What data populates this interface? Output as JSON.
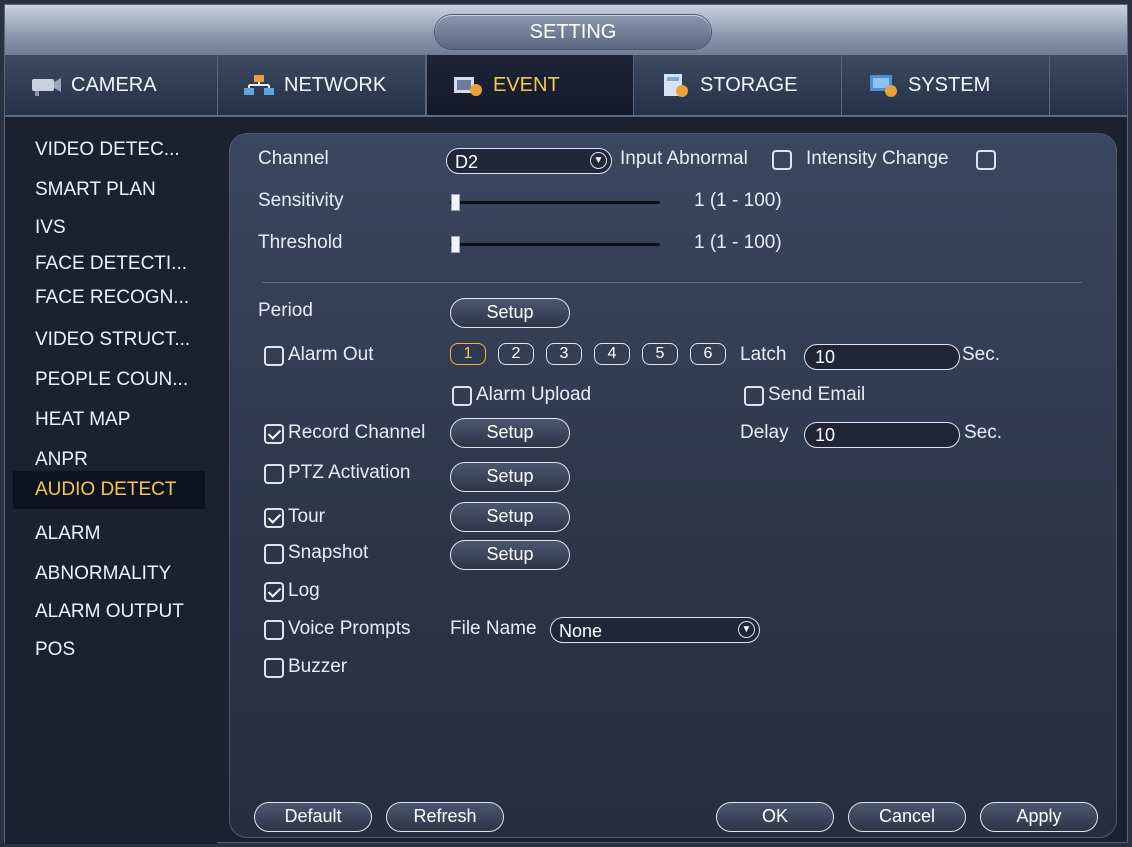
{
  "window": {
    "title": "SETTING"
  },
  "tabs": [
    {
      "label": "CAMERA",
      "icon": "camera-icon"
    },
    {
      "label": "NETWORK",
      "icon": "network-icon"
    },
    {
      "label": "EVENT",
      "icon": "event-icon",
      "active": true
    },
    {
      "label": "STORAGE",
      "icon": "storage-icon"
    },
    {
      "label": "SYSTEM",
      "icon": "system-icon"
    }
  ],
  "sidebar": {
    "items": [
      {
        "label": "VIDEO DETEC..."
      },
      {
        "label": "SMART PLAN"
      },
      {
        "label": "IVS"
      },
      {
        "label": "FACE DETECTI..."
      },
      {
        "label": "FACE RECOGN..."
      },
      {
        "label": "VIDEO STRUCT..."
      },
      {
        "label": "PEOPLE COUN..."
      },
      {
        "label": "HEAT MAP"
      },
      {
        "label": "ANPR"
      },
      {
        "label": "AUDIO DETECT",
        "active": true
      },
      {
        "label": "ALARM"
      },
      {
        "label": "ABNORMALITY"
      },
      {
        "label": "ALARM OUTPUT"
      },
      {
        "label": "POS"
      }
    ]
  },
  "form": {
    "channel_label": "Channel",
    "channel_value": "D2",
    "input_abnormal_label": "Input Abnormal",
    "input_abnormal_checked": false,
    "intensity_change_label": "Intensity Change",
    "intensity_change_checked": false,
    "sensitivity_label": "Sensitivity",
    "sensitivity_value": 1,
    "sensitivity_text": "1 (1 - 100)",
    "threshold_label": "Threshold",
    "threshold_value": 1,
    "threshold_text": "1 (1 - 100)",
    "period_label": "Period",
    "setup_label": "Setup",
    "alarm_out_label": "Alarm Out",
    "alarm_out_checked": false,
    "alarm_outputs": [
      "1",
      "2",
      "3",
      "4",
      "5",
      "6"
    ],
    "alarm_output_selected": "1",
    "latch_label": "Latch",
    "latch_value": "10",
    "sec_label": "Sec.",
    "alarm_upload_label": "Alarm Upload",
    "alarm_upload_checked": false,
    "send_email_label": "Send Email",
    "send_email_checked": false,
    "record_channel_label": "Record Channel",
    "record_channel_checked": true,
    "delay_label": "Delay",
    "delay_value": "10",
    "ptz_label": "PTZ Activation",
    "ptz_checked": false,
    "tour_label": "Tour",
    "tour_checked": true,
    "snapshot_label": "Snapshot",
    "snapshot_checked": false,
    "log_label": "Log",
    "log_checked": true,
    "voice_prompts_label": "Voice Prompts",
    "voice_prompts_checked": false,
    "file_name_label": "File Name",
    "file_name_value": "None",
    "buzzer_label": "Buzzer",
    "buzzer_checked": false
  },
  "footer": {
    "default_label": "Default",
    "refresh_label": "Refresh",
    "ok_label": "OK",
    "cancel_label": "Cancel",
    "apply_label": "Apply"
  },
  "colors": {
    "accent": "#f5c84a",
    "background": "#1c2130",
    "panel": "#2c3549"
  }
}
